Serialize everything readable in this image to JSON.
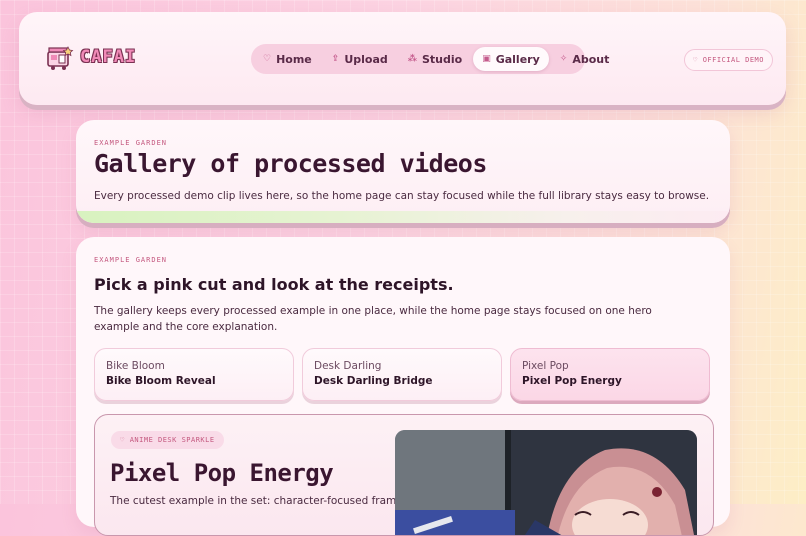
{
  "brand": {
    "name": "CAFAI"
  },
  "nav": {
    "items": [
      {
        "label": "Home",
        "icon": "heart-icon"
      },
      {
        "label": "Upload",
        "icon": "upload-icon"
      },
      {
        "label": "Studio",
        "icon": "sparkle-icon"
      },
      {
        "label": "Gallery",
        "icon": "film-icon",
        "active": true
      },
      {
        "label": "About",
        "icon": "stars-icon"
      }
    ]
  },
  "badge": {
    "label": "OFFICIAL DEMO",
    "icon": "heart-icon"
  },
  "hero": {
    "eyebrow": "EXAMPLE GARDEN",
    "title": "Gallery of processed videos",
    "description": "Every processed demo clip lives here, so the home page can stay focused while the full library stays easy to browse."
  },
  "picker": {
    "eyebrow": "EXAMPLE GARDEN",
    "title": "Pick a pink cut and look at the receipts.",
    "description": "The gallery keeps every processed example in one place, while the home page stays focused on one hero example and the core explanation.",
    "tiles": [
      {
        "kicker": "Bike Bloom",
        "title": "Bike Bloom Reveal"
      },
      {
        "kicker": "Desk Darling",
        "title": "Desk Darling Bridge"
      },
      {
        "kicker": "Pixel Pop",
        "title": "Pixel Pop Energy",
        "selected": true
      }
    ]
  },
  "feature": {
    "tag": "ANIME DESK SPARKLE",
    "title": "Pixel Pop Energy",
    "description": "The cutest example in the set: character-focused framing,"
  },
  "colors": {
    "accent": "#c4587f",
    "brand_pink": "#f08ab7",
    "nav_bg": "#f7cfe0"
  }
}
